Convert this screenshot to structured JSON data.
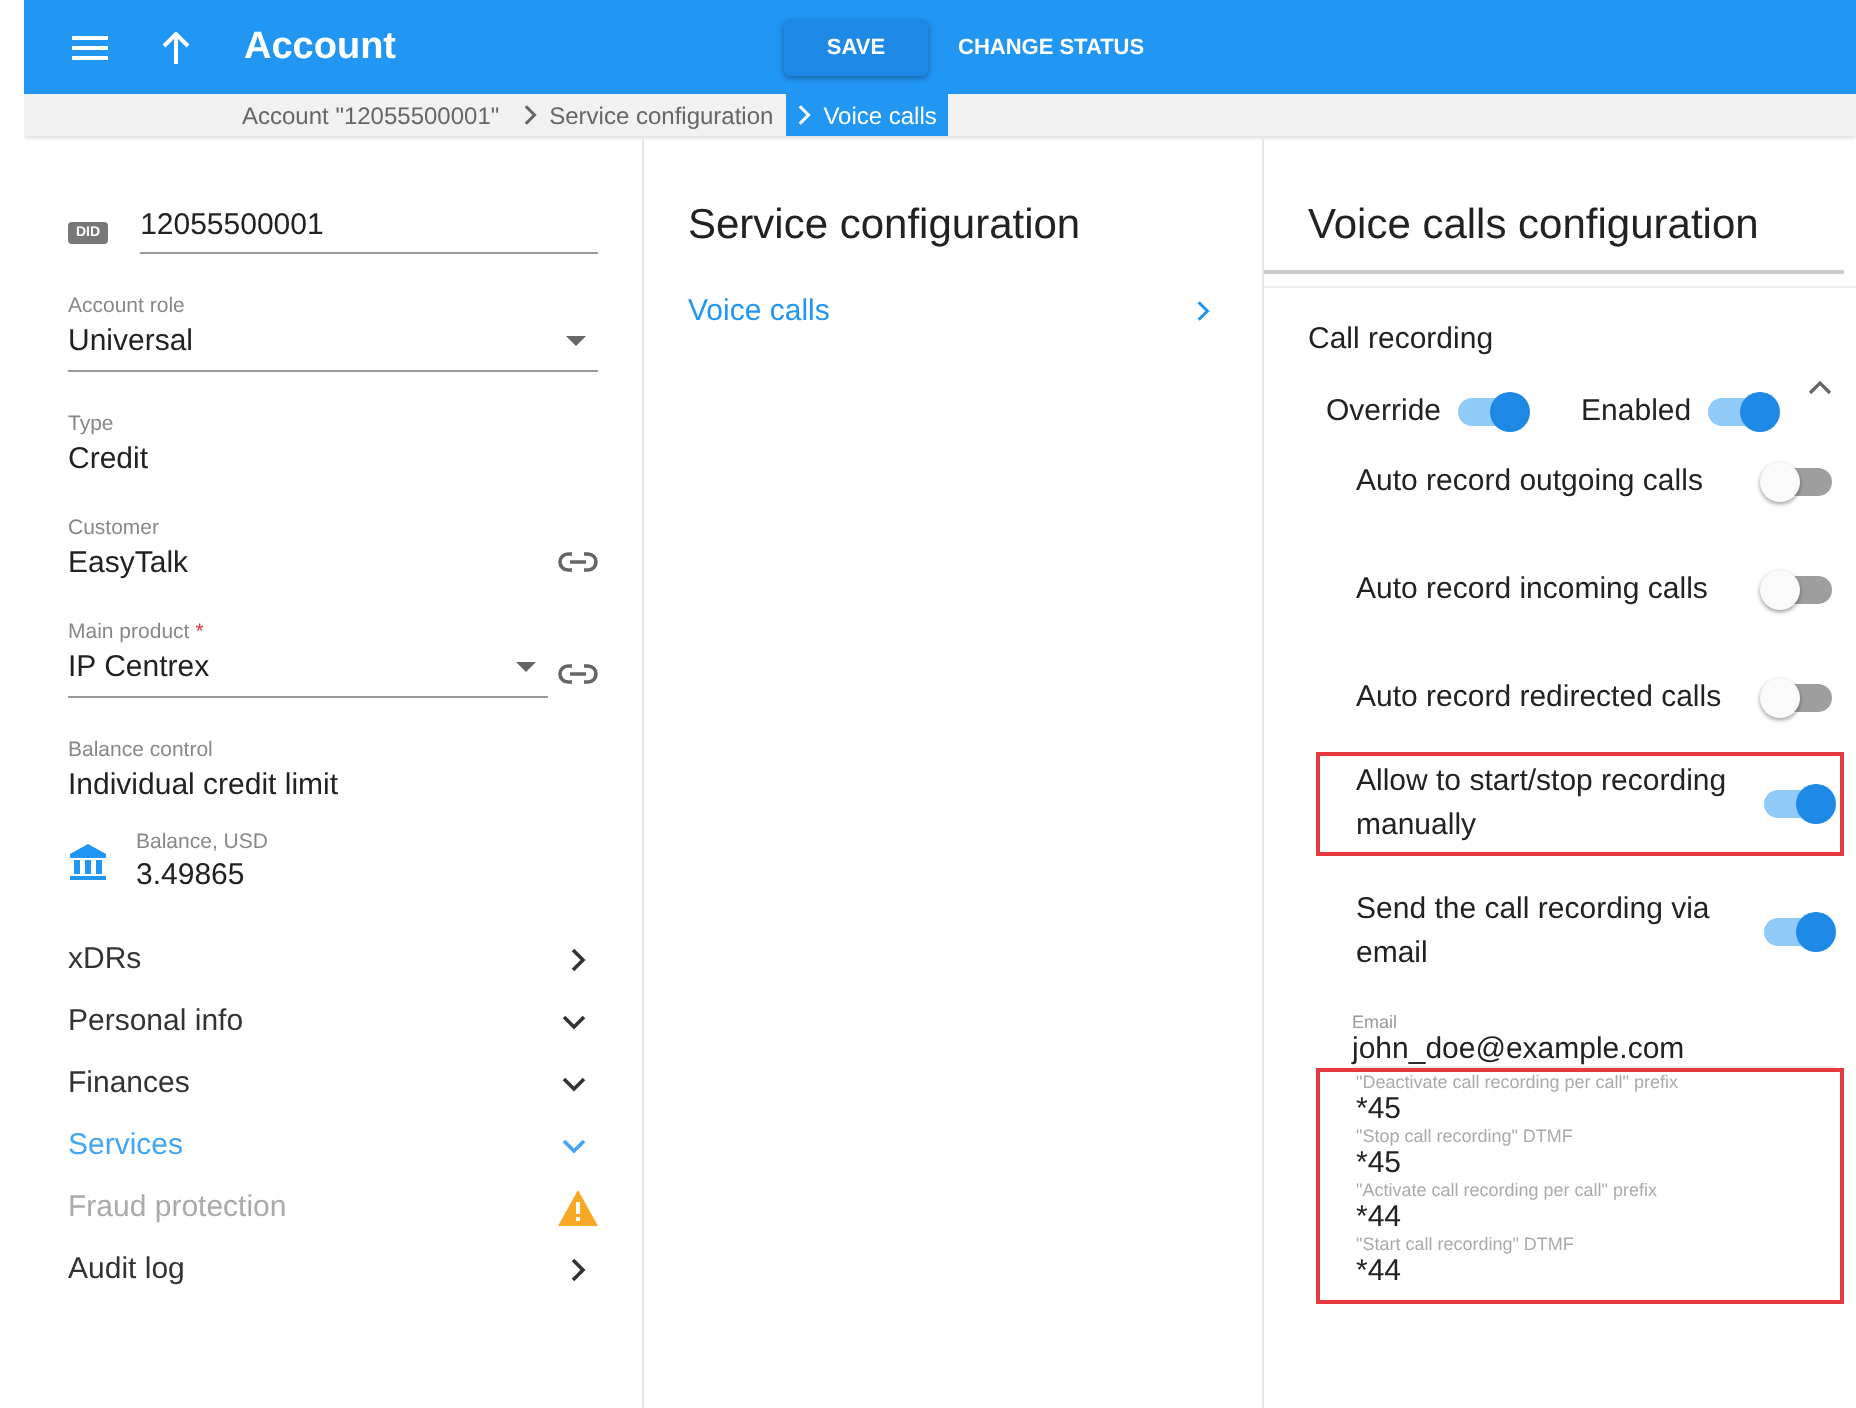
{
  "header": {
    "title": "Account",
    "actions": [
      {
        "label": "SAVE",
        "kind": "raised"
      },
      {
        "label": "CHANGE STATUS",
        "kind": "flat"
      }
    ]
  },
  "breadcrumbs": [
    {
      "label": "Account \"12055500001\"",
      "selected": false
    },
    {
      "label": "Service configuration",
      "selected": false
    },
    {
      "label": "Voice calls",
      "selected": true
    }
  ],
  "account": {
    "badge": "DID",
    "did": "12055500001",
    "fields": [
      {
        "label": "Account role",
        "value": "Universal",
        "kind": "select"
      },
      {
        "label": "Type",
        "value": "Credit",
        "kind": "text"
      },
      {
        "label": "Customer",
        "value": "EasyTalk",
        "kind": "link"
      },
      {
        "label": "Main product",
        "required": true,
        "required_mark": "*",
        "value": "IP Centrex",
        "kind": "select-link"
      },
      {
        "label": "Balance control",
        "value": "Individual credit limit",
        "kind": "text"
      }
    ],
    "balance": {
      "label": "Balance, USD",
      "value": "3.49865"
    },
    "nav": [
      {
        "label": "xDRs",
        "kind": "link",
        "selected": false,
        "disabled": false
      },
      {
        "label": "Personal info",
        "kind": "group",
        "selected": false,
        "disabled": false
      },
      {
        "label": "Finances",
        "kind": "group",
        "selected": false,
        "disabled": false
      },
      {
        "label": "Services",
        "kind": "group",
        "selected": true,
        "disabled": false
      },
      {
        "label": "Fraud protection",
        "kind": "alert",
        "selected": false,
        "disabled": true
      },
      {
        "label": "Audit log",
        "kind": "link",
        "selected": false,
        "disabled": false
      }
    ]
  },
  "service_configuration": {
    "title": "Service configuration",
    "items": [
      {
        "label": "Voice calls"
      }
    ]
  },
  "voice_calls": {
    "title": "Voice calls configuration",
    "section": "Call recording",
    "expanded": true,
    "switches": [
      {
        "label": "Override",
        "on": true
      },
      {
        "label": "Enabled",
        "on": true
      }
    ],
    "options": [
      {
        "label": "Auto record outgoing calls",
        "on": false,
        "highlighted": false
      },
      {
        "label": "Auto record incoming calls",
        "on": false,
        "highlighted": false
      },
      {
        "label": "Auto record redirected calls",
        "on": false,
        "highlighted": false
      },
      {
        "label": "Allow to start/stop recording manually",
        "on": true,
        "highlighted": true
      },
      {
        "label": "Send the call recording via email",
        "on": true,
        "highlighted": false
      }
    ],
    "email": {
      "label": "Email",
      "value": "john_doe@example.com"
    },
    "prefixes_highlighted": true,
    "prefixes": [
      {
        "label": "\"Deactivate call recording per call\" prefix",
        "value": "*45"
      },
      {
        "label": "\"Stop call recording\" DTMF",
        "value": "*45"
      },
      {
        "label": "\"Activate call recording per call\" prefix",
        "value": "*44"
      },
      {
        "label": "\"Start call recording\" DTMF",
        "value": "*44"
      }
    ]
  }
}
